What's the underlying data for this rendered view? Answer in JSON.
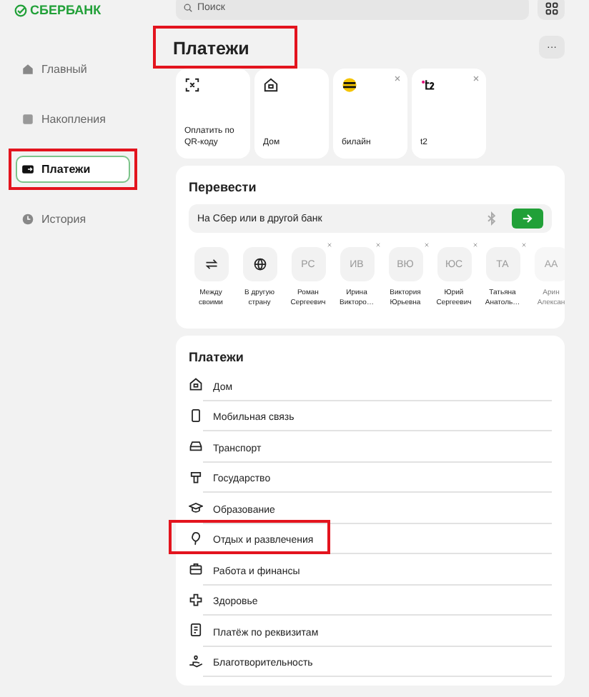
{
  "brand": "СБЕРБАНК",
  "search": {
    "placeholder": "Поиск"
  },
  "sidebar": {
    "items": [
      {
        "label": "Главный",
        "selected": false,
        "annotated": false
      },
      {
        "label": "Накопления",
        "selected": false,
        "annotated": false
      },
      {
        "label": "Платежи",
        "selected": true,
        "annotated": true
      },
      {
        "label": "История",
        "selected": false,
        "annotated": false
      }
    ]
  },
  "page_title": {
    "text": "Платежи",
    "annotated": true
  },
  "more_button": "···",
  "quick_tiles": [
    {
      "label": "Оплатить по QR-коду",
      "removable": false
    },
    {
      "label": "Дом",
      "removable": false
    },
    {
      "label": "билайн",
      "removable": true
    },
    {
      "label": "t2",
      "removable": true
    }
  ],
  "transfer": {
    "title": "Перевести",
    "field_placeholder": "На Сбер или в другой банк",
    "contacts": [
      {
        "kind": "action",
        "name": "Между своими",
        "faded": false,
        "removable": false
      },
      {
        "kind": "action",
        "name": "В другую страну",
        "faded": false,
        "removable": false
      },
      {
        "kind": "person",
        "initials": "РС",
        "name": "Роман Сергеевич",
        "faded": false,
        "removable": true
      },
      {
        "kind": "person",
        "initials": "ИВ",
        "name": "Ирина Викторо…",
        "faded": false,
        "removable": true
      },
      {
        "kind": "person",
        "initials": "ВЮ",
        "name": "Виктория Юрьевна",
        "faded": false,
        "removable": true
      },
      {
        "kind": "person",
        "initials": "ЮС",
        "name": "Юрий Сергеевич",
        "faded": false,
        "removable": true
      },
      {
        "kind": "person",
        "initials": "ТА",
        "name": "Татьяна Анатоль…",
        "faded": false,
        "removable": true
      },
      {
        "kind": "person",
        "initials": "АА",
        "name": "Арин Алексан",
        "faded": true,
        "removable": false
      }
    ]
  },
  "payments": {
    "title": "Платежи",
    "items": [
      {
        "label": "Дом",
        "annotated": false
      },
      {
        "label": "Мобильная связь",
        "annotated": false
      },
      {
        "label": "Транспорт",
        "annotated": false
      },
      {
        "label": "Государство",
        "annotated": false
      },
      {
        "label": "Образование",
        "annotated": false
      },
      {
        "label": "Отдых и развлечения",
        "annotated": true
      },
      {
        "label": "Работа и финансы",
        "annotated": false
      },
      {
        "label": "Здоровье",
        "annotated": false
      },
      {
        "label": "Платёж по реквизитам",
        "annotated": false
      },
      {
        "label": "Благотворительность",
        "annotated": false
      }
    ]
  }
}
